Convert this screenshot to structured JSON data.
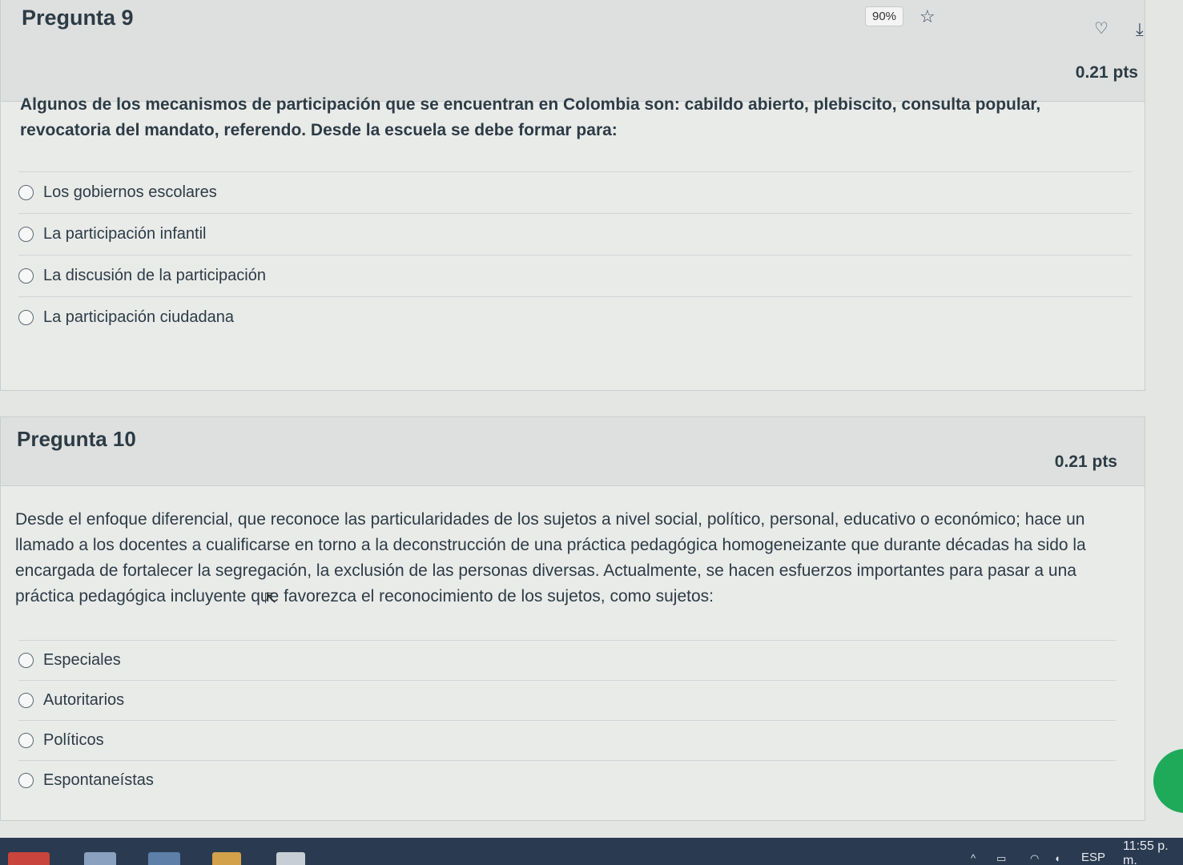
{
  "browser": {
    "zoom": "90%"
  },
  "questions": [
    {
      "title": "Pregunta 9",
      "points": "0.21 pts",
      "text": "Algunos de los mecanismos de participación que se encuentran en Colombia son: cabildo abierto, plebiscito, consulta popular, revocatoria del mandato, referendo. Desde la escuela se debe formar para:",
      "answers": [
        "Los gobiernos escolares",
        "La participación infantil",
        "La discusión de la participación",
        "La participación ciudadana"
      ]
    },
    {
      "title": "Pregunta 10",
      "points": "0.21 pts",
      "text": "Desde el enfoque diferencial, que reconoce las particularidades de los sujetos a nivel social, político, personal, educativo o económico; hace un llamado a los docentes a cualificarse en torno a la deconstrucción de una práctica pedagógica homogeneizante que durante décadas ha sido la encargada de fortalecer la segregación, la exclusión de las personas diversas. Actualmente, se hacen esfuerzos importantes para pasar a una práctica pedagógica incluyente que favorezca el reconocimiento de los sujetos, como sujetos:",
      "answers": [
        "Especiales",
        "Autoritarios",
        "Políticos",
        "Espontaneístas"
      ]
    }
  ],
  "taskbar": {
    "language": "ESP",
    "clock": "11:55 p. m."
  },
  "colors": {
    "text": "#2d3b45",
    "header_bg": "#dde0de",
    "card_bg": "#e9ebe9",
    "taskbar": "#2a3a50"
  }
}
